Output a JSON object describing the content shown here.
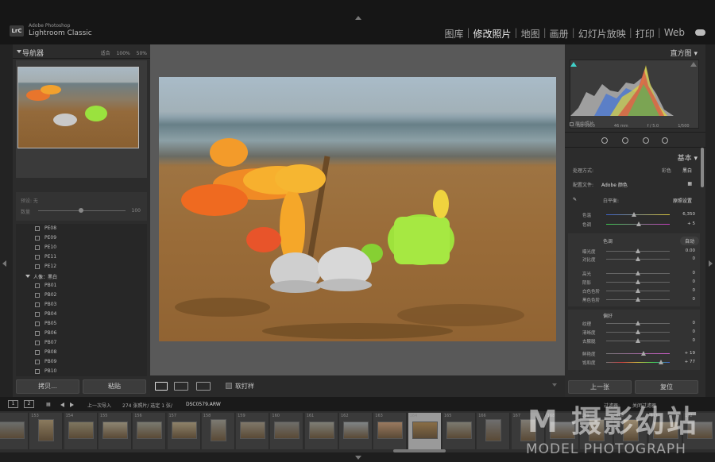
{
  "app": {
    "badge": "LrC",
    "vendor": "Adobe Photoshop",
    "name": "Lightroom Classic"
  },
  "modules": [
    "图库",
    "修改照片",
    "地图",
    "画册",
    "幻灯片放映",
    "打印",
    "Web"
  ],
  "active_module": "修改照片",
  "navigator": {
    "title": "导航器",
    "zoom_options": [
      "适合",
      "100%",
      "50%"
    ]
  },
  "preset_amount": {
    "label": "预设: 无",
    "amount_label": "数量",
    "amount_value": "100",
    "amount_fraction": 0.5
  },
  "presets": {
    "pe_items": [
      "PE08",
      "PE09",
      "PE10",
      "PE11",
      "PE12"
    ],
    "group_label": "人像：黑白",
    "pb_items": [
      "PB01",
      "PB02",
      "PB03",
      "PB04",
      "PB05",
      "PB06",
      "PB07",
      "PB08",
      "PB09",
      "PB10"
    ]
  },
  "left_buttons": {
    "copy": "拷贝...",
    "paste": "粘贴"
  },
  "toolbar": {
    "soft_proof": "软打样"
  },
  "histogram": {
    "title": "直方图",
    "iso": "ISO 5000",
    "focal": "46 mm",
    "aperture": "f / 5.0",
    "shutter": "1/500",
    "original_photo": "原始照片"
  },
  "basic": {
    "title": "基本",
    "treatment_label": "处理方式:",
    "treatment_color": "彩色",
    "treatment_bw": "黑白",
    "profile_label": "配置文件:",
    "profile_value": "Adobe 颜色",
    "wb_label": "白平衡:",
    "wb_value": "原照设置",
    "temp_label": "色温",
    "temp_value": "6,350",
    "tint_label": "色调",
    "tint_value": "+ 5",
    "tone_label": "色调",
    "auto_label": "自动",
    "exposure_label": "曝光度",
    "exposure_value": "0.00",
    "contrast_label": "对比度",
    "contrast_value": "0",
    "highlights_label": "高光",
    "highlights_value": "0",
    "shadows_label": "阴影",
    "shadows_value": "0",
    "whites_label": "白色色阶",
    "whites_value": "0",
    "blacks_label": "黑色色阶",
    "blacks_value": "0",
    "presence_label": "偏好",
    "texture_label": "纹理",
    "texture_value": "0",
    "clarity_label": "清晰度",
    "clarity_value": "0",
    "dehaze_label": "去朦胧",
    "dehaze_value": "0",
    "vibrance_label": "鲜艳度",
    "vibrance_value": "+ 19",
    "saturation_label": "饱和度",
    "saturation_value": "+ 77"
  },
  "right_buttons": {
    "previous": "上一张",
    "reset": "复位"
  },
  "filmbar": {
    "page1": "1",
    "page2": "2",
    "source": "上一次导入",
    "count": "274 张照片/ 选定 1 张/",
    "filename": "DSC0579.ARW",
    "filter_label": "过滤器:",
    "filter_value": "关闭过滤器"
  },
  "filmstrip": {
    "numbers": [
      "",
      "153",
      "154",
      "155",
      "156",
      "157",
      "158",
      "159",
      "160",
      "161",
      "162",
      "163",
      "164",
      "165",
      "166",
      "167",
      "168",
      "169",
      "170",
      "171",
      "172"
    ],
    "selected_index": 12
  },
  "watermark": {
    "big": "M 摄影幼站",
    "small": "MODEL PHOTOGRAPH"
  }
}
